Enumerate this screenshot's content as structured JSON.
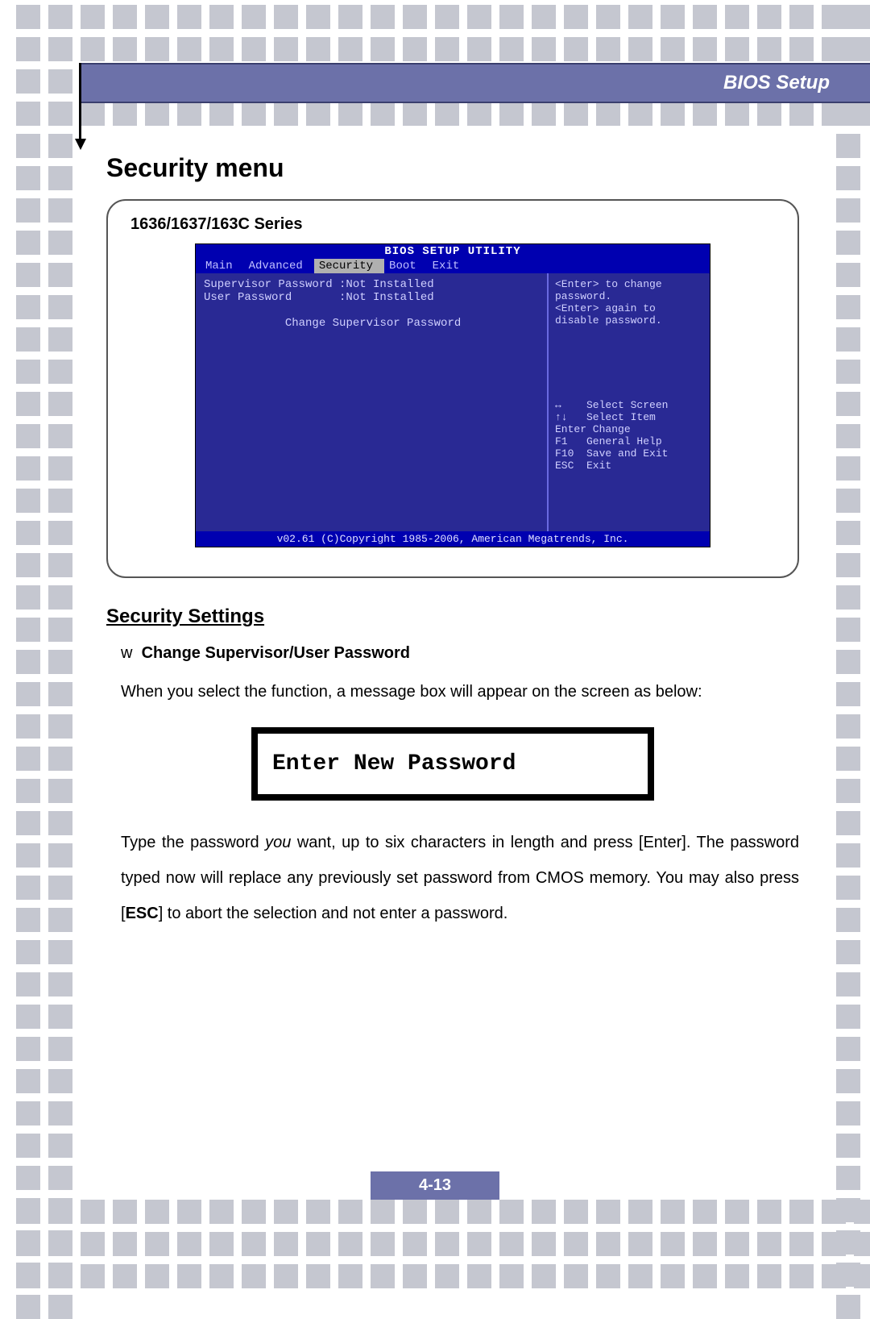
{
  "header": {
    "title": "BIOS Setup"
  },
  "page": {
    "title": "Security menu",
    "series_label": "1636/1637/163C Series",
    "section_heading": "Security Settings",
    "bullet_marker": "w",
    "bullet_title": "Change Supervisor/User Password",
    "para1": "When you select the function, a message box will appear on the screen as below:",
    "password_box": "Enter New Password",
    "para2_a": "Type the password ",
    "para2_you": "you",
    "para2_b": " want, up to six characters in length and press [Enter].   The password typed now will replace any previously set password from CMOS memory. You may also press [",
    "para2_esc": "ESC",
    "para2_c": "] to abort the selection and not enter a password.",
    "page_number": "4-13"
  },
  "bios": {
    "title": "BIOS SETUP UTILITY",
    "menu": [
      "Main",
      "Advanced",
      "Security",
      "Boot",
      "Exit"
    ],
    "active_menu_index": 2,
    "left_rows": [
      "Supervisor Password :Not Installed",
      "User Password       :Not Installed",
      "",
      "Change Supervisor Password"
    ],
    "help_lines": [
      "<Enter> to change",
      "password.",
      "<Enter> again to",
      "disable password."
    ],
    "key_lines": [
      "↔    Select Screen",
      "↑↓   Select Item",
      "Enter Change",
      "F1   General Help",
      "F10  Save and Exit",
      "ESC  Exit"
    ],
    "footer": "v02.61 (C)Copyright 1985-2006, American Megatrends, Inc."
  }
}
